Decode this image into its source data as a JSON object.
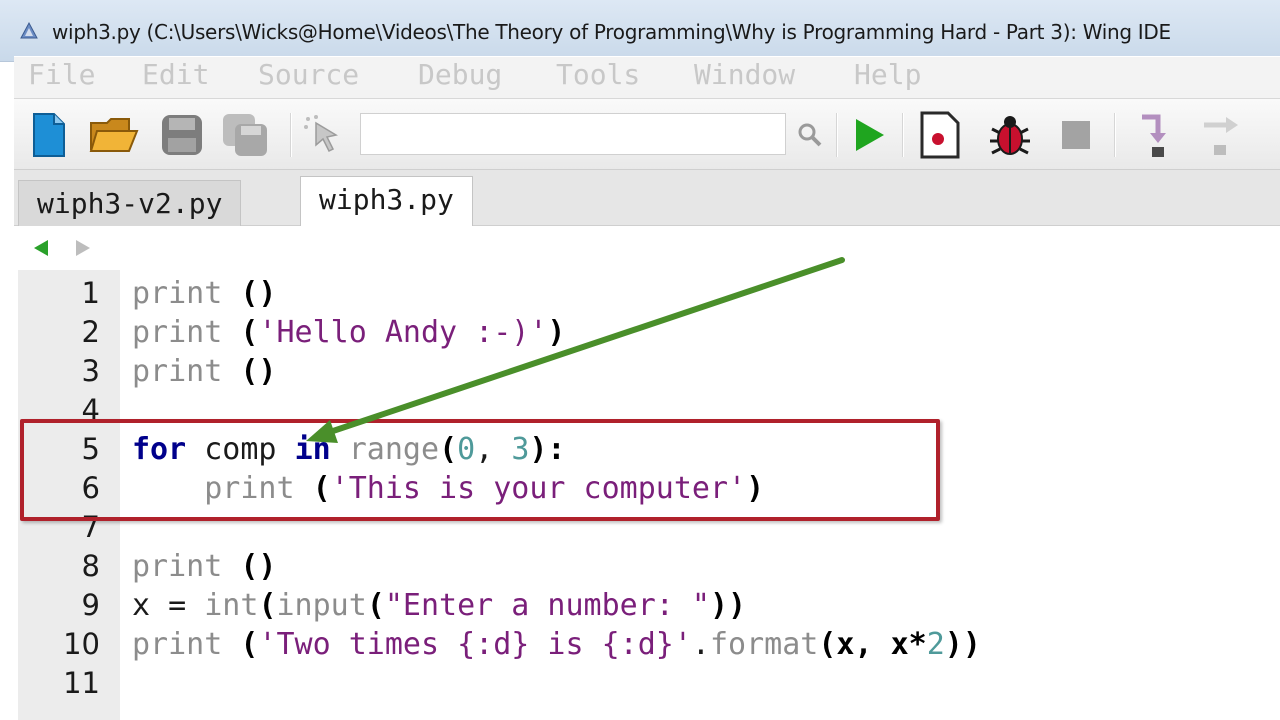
{
  "window": {
    "title": "wiph3.py (C:\\Users\\Wicks@Home\\Videos\\The Theory of Programming\\Why is Programming Hard - Part 3): Wing IDE"
  },
  "menu": {
    "items": [
      "File",
      "Edit",
      "Source",
      "Debug",
      "Tools",
      "Window",
      "Help"
    ]
  },
  "toolbar": {
    "search_value": "",
    "icons": [
      "new-file-icon",
      "open-folder-icon",
      "save-icon",
      "save-all-icon",
      "pointer-icon",
      "search-icon",
      "run-icon",
      "breakpoint-icon",
      "debug-bug-icon",
      "stop-icon",
      "step-into-icon",
      "step-over-icon"
    ]
  },
  "tabs": [
    {
      "label": "wiph3-v2.py",
      "active": false
    },
    {
      "label": "wiph3.py",
      "active": true
    }
  ],
  "colors": {
    "keyword": "#00008b",
    "builtin": "#8c8c8c",
    "string": "#7a1f7a",
    "number": "#4f9a9a",
    "highlight_box": "#b0212b",
    "arrow": "#4a8f2a"
  },
  "editor": {
    "lines": [
      {
        "n": "1"
      },
      {
        "n": "2"
      },
      {
        "n": "3"
      },
      {
        "n": "4"
      },
      {
        "n": "5"
      },
      {
        "n": "6"
      },
      {
        "n": "7"
      },
      {
        "n": "8"
      },
      {
        "n": "9"
      },
      {
        "n": "10"
      },
      {
        "n": "11"
      }
    ],
    "tokens": {
      "l1_a": "print",
      "l1_b": " ()",
      "l2_a": "print",
      "l2_b": " (",
      "l2_c": "'Hello Andy :-)'",
      "l2_d": ")",
      "l3_a": "print",
      "l3_b": " ()",
      "l5_a": "for",
      "l5_b": " comp ",
      "l5_c": "in",
      "l5_d": " ",
      "l5_e": "range",
      "l5_f": "(",
      "l5_g": "0",
      "l5_h": ", ",
      "l5_i": "3",
      "l5_j": "):",
      "l6_a": "    ",
      "l6_b": "print",
      "l6_c": " (",
      "l6_d": "'This is your computer'",
      "l6_e": ")",
      "l8_a": "print",
      "l8_b": " ()",
      "l9_a": "x = ",
      "l9_b": "int",
      "l9_c": "(",
      "l9_d": "input",
      "l9_e": "(",
      "l9_f": "\"Enter a number: \"",
      "l9_g": "))",
      "l10_a": "print",
      "l10_b": " (",
      "l10_c": "'Two times {:d} is {:d}'",
      "l10_d": ".",
      "l10_e": "format",
      "l10_f": "(x, x*",
      "l10_g": "2",
      "l10_h": "))"
    }
  }
}
